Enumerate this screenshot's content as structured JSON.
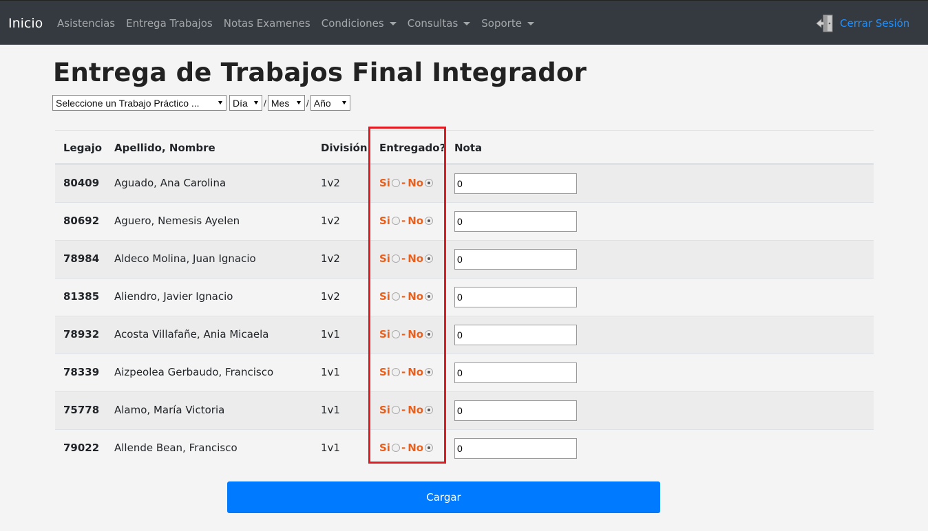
{
  "navbar": {
    "brand": "Inicio",
    "links": [
      "Asistencias",
      "Entrega Trabajos",
      "Notas Examenes"
    ],
    "dropdowns": [
      "Condiciones",
      "Consultas",
      "Soporte"
    ],
    "logout_label": "Cerrar Sesión",
    "colors": {
      "background": "#343a40",
      "link": "#1e90ff"
    }
  },
  "page": {
    "title": "Entrega de Trabajos Final Integrador"
  },
  "filters": {
    "trabajo": "Seleccione un Trabajo Práctico ...",
    "dia": "Día",
    "mes": "Mes",
    "anio": "Año",
    "separator": "/"
  },
  "table": {
    "headers": {
      "legajo": "Legajo",
      "nombre": "Apellido, Nombre",
      "division": "División",
      "entregado": "Entregado?",
      "nota": "Nota"
    },
    "si_label": "Si",
    "no_label": "No",
    "dash": "-",
    "rows": [
      {
        "legajo": "80409",
        "nombre": "Aguado, Ana Carolina",
        "division": "1v2",
        "entregado": "No",
        "nota": "0"
      },
      {
        "legajo": "80692",
        "nombre": "Aguero, Nemesis Ayelen",
        "division": "1v2",
        "entregado": "No",
        "nota": "0"
      },
      {
        "legajo": "78984",
        "nombre": "Aldeco Molina, Juan Ignacio",
        "division": "1v2",
        "entregado": "No",
        "nota": "0"
      },
      {
        "legajo": "81385",
        "nombre": "Aliendro, Javier Ignacio",
        "division": "1v2",
        "entregado": "No",
        "nota": "0"
      },
      {
        "legajo": "78932",
        "nombre": "Acosta Villafañe, Ania Micaela",
        "division": "1v1",
        "entregado": "No",
        "nota": "0"
      },
      {
        "legajo": "78339",
        "nombre": "Aizpeolea Gerbaudo, Francisco",
        "division": "1v1",
        "entregado": "No",
        "nota": "0"
      },
      {
        "legajo": "75778",
        "nombre": "Alamo, María Victoria",
        "division": "1v1",
        "entregado": "No",
        "nota": "0"
      },
      {
        "legajo": "79022",
        "nombre": "Allende Bean, Francisco",
        "division": "1v1",
        "entregado": "No",
        "nota": "0"
      }
    ]
  },
  "actions": {
    "submit_label": "Cargar",
    "submit_color": "#007bff"
  },
  "annotation": {
    "highlight_color": "#e21b23"
  }
}
